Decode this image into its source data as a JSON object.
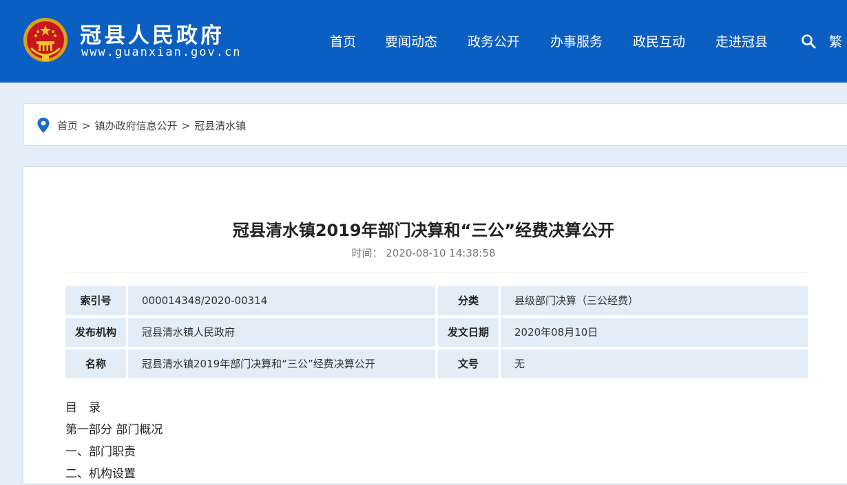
{
  "header": {
    "site_title": "冠县人民政府",
    "site_url": "www.guanxian.gov.cn",
    "nav": [
      "首页",
      "要闻动态",
      "政务公开",
      "办事服务",
      "政民互动",
      "走进冠县"
    ],
    "lang_switch": "繁",
    "colors": {
      "bar": "#0b5fc2",
      "text": "#ffffff"
    }
  },
  "breadcrumb": {
    "items": [
      "首页",
      "镇办政府信息公开",
      "冠县清水镇"
    ],
    "separator": ">"
  },
  "article": {
    "title": "冠县清水镇2019年部门决算和“三公”经费决算公开",
    "time_label": "时间：",
    "time_value": "2020-08-10 14:38:58"
  },
  "meta": {
    "rows": [
      {
        "k1": "索引号",
        "v1": "000014348/2020-00314",
        "k2": "分类",
        "v2": "县级部门决算（三公经费）"
      },
      {
        "k1": "发布机构",
        "v1": "冠县清水镇人民政府",
        "k2": "发文日期",
        "v2": "2020年08月10日"
      },
      {
        "k1": "名称",
        "v1": "冠县清水镇2019年部门决算和“三公”经费决算公开",
        "k2": "文号",
        "v2": "无"
      }
    ]
  },
  "body": {
    "lines": [
      "目　录",
      "第一部分  部门概况",
      "一、部门职责",
      "二、机构设置"
    ]
  }
}
